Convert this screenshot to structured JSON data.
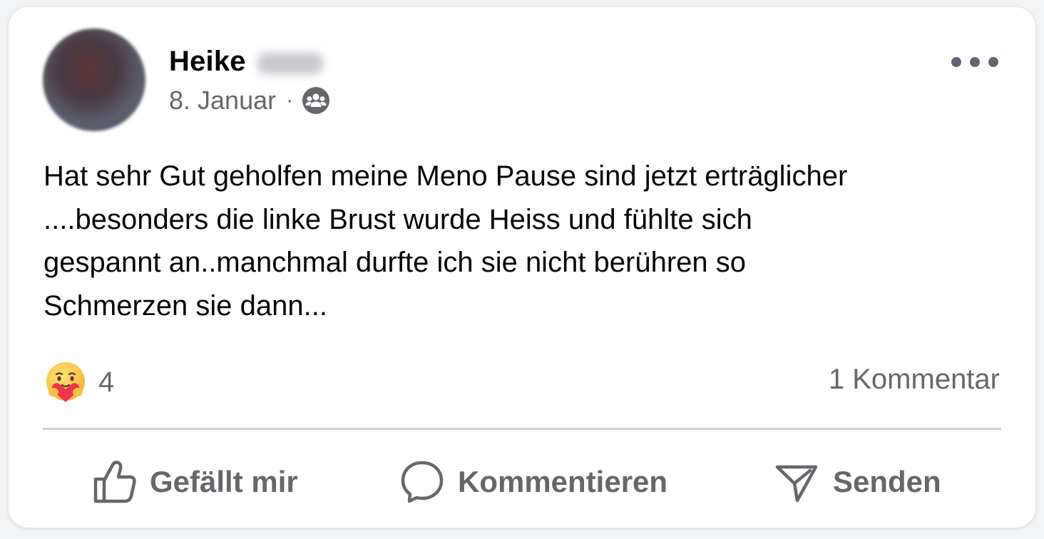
{
  "post": {
    "author_name": "Heike",
    "date": "8. Januar",
    "separator": "·",
    "audience_icon": "group-icon",
    "body": "Hat sehr Gut geholfen meine Meno Pause sind jetzt erträglicher\n....besonders die linke Brust wurde Heiss und fühlte sich\ngespannt an..manchmal durfte ich sie nicht berühren so\nSchmerzen sie dann...",
    "more_icon": "more-horizontal-icon"
  },
  "stats": {
    "reaction_emoji": "care-reaction-icon",
    "reaction_count": "4",
    "comments": "1 Kommentar"
  },
  "actions": {
    "like_label": "Gefällt mir",
    "comment_label": "Kommentieren",
    "share_label": "Senden"
  },
  "colors": {
    "primary_text": "#050505",
    "secondary_text": "#65676b",
    "divider": "#ced0d4",
    "card_background": "#ffffff"
  }
}
